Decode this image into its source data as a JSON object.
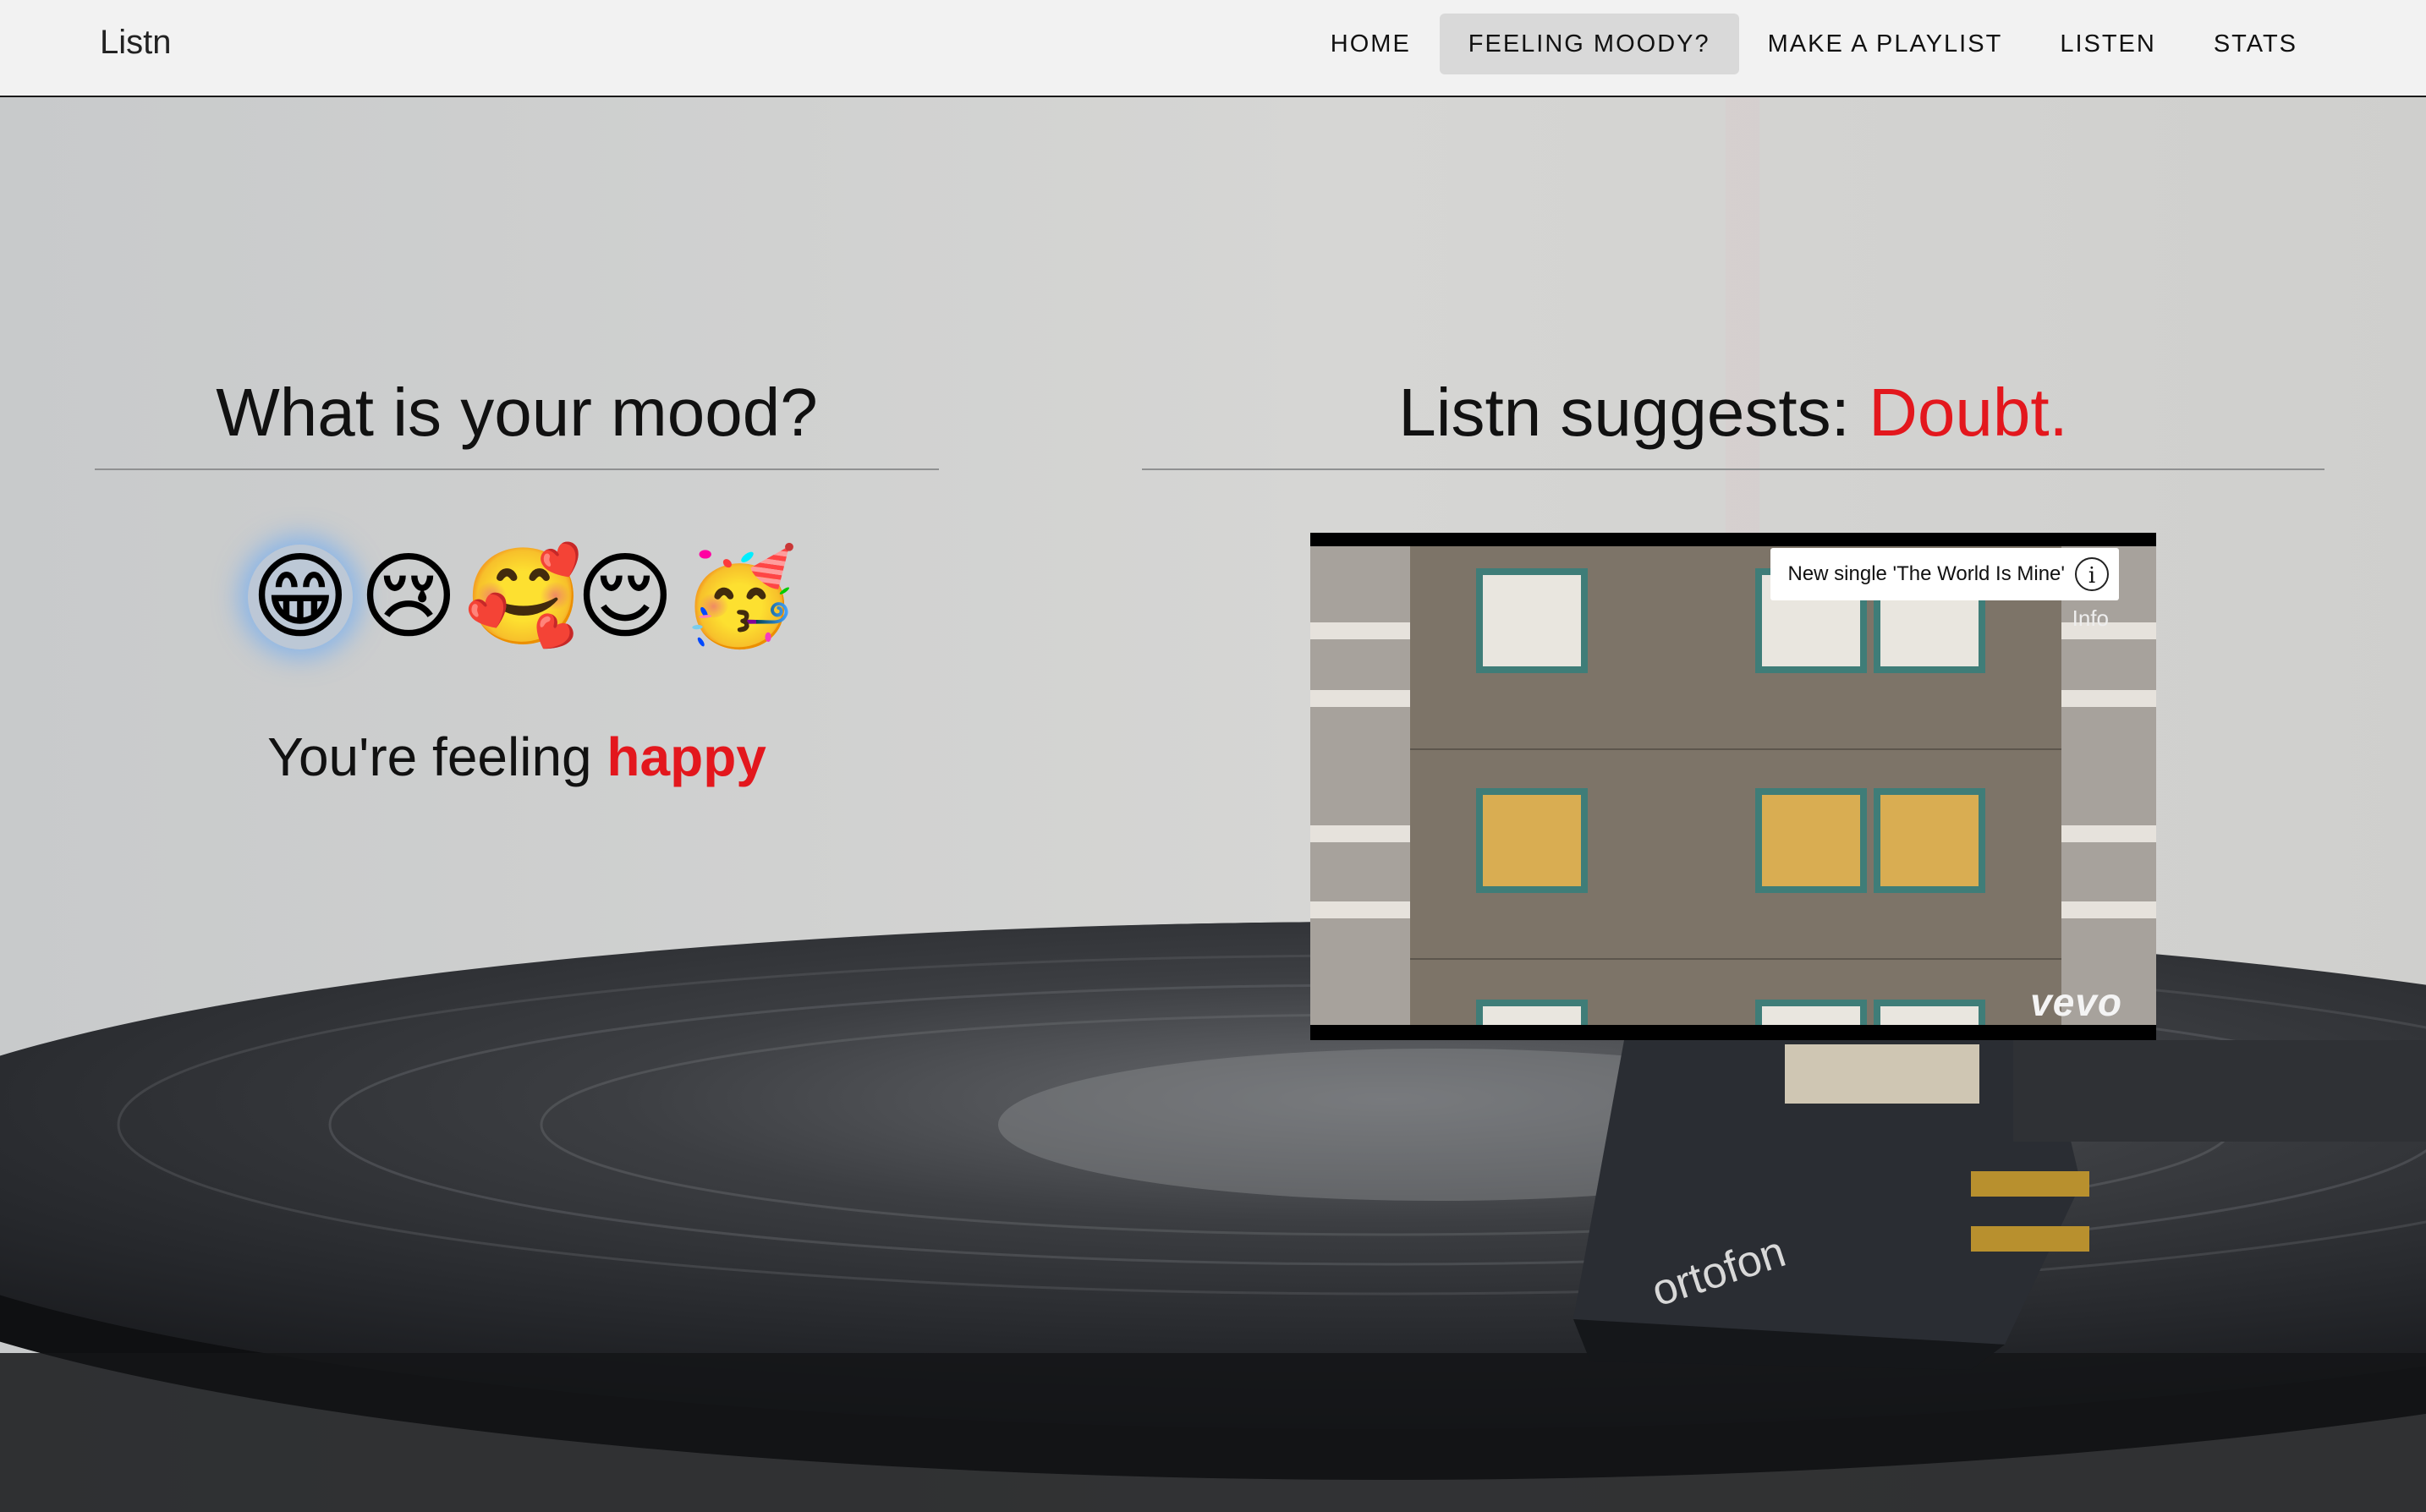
{
  "brand": "Listn",
  "nav": {
    "items": [
      {
        "label": "HOME",
        "active": false
      },
      {
        "label": "FEELING MOODY?",
        "active": true
      },
      {
        "label": "MAKE A PLAYLIST",
        "active": false
      },
      {
        "label": "LISTEN",
        "active": false
      },
      {
        "label": "STATS",
        "active": false
      }
    ]
  },
  "mood": {
    "title": "What is your mood?",
    "emojis": [
      {
        "glyph": "😁",
        "name": "happy",
        "selected": true
      },
      {
        "glyph": "😢",
        "name": "sad",
        "selected": false
      },
      {
        "glyph": "🥰",
        "name": "loving",
        "selected": false
      },
      {
        "glyph": "😌",
        "name": "relieved",
        "selected": false
      },
      {
        "glyph": "🥳",
        "name": "party",
        "selected": false
      }
    ],
    "feeling_prefix": "You're feeling",
    "feeling_value": "happy"
  },
  "suggestion": {
    "prefix": "Listn suggests:",
    "song": "Doubt.",
    "video": {
      "title": "New single 'The World Is Mine'",
      "info_label": "Info",
      "watermark": "vevo"
    }
  },
  "colors": {
    "accent": "#e3171d",
    "navbar_bg": "#f2f2f2",
    "active_nav_bg": "#d9d9d9"
  }
}
